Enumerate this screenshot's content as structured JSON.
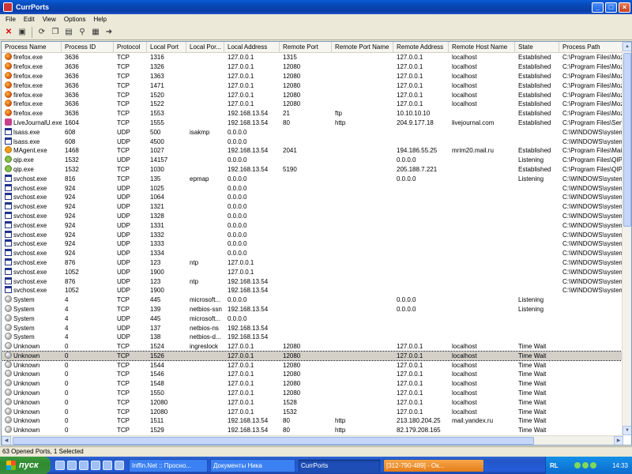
{
  "window": {
    "title": "CurrPorts"
  },
  "menu": [
    "File",
    "Edit",
    "View",
    "Options",
    "Help"
  ],
  "toolbar": {
    "icons": [
      "close-connection-icon",
      "save-icon",
      "refresh-icon",
      "copy-icon",
      "properties-icon",
      "find-icon",
      "html-report-icon",
      "exit-icon"
    ]
  },
  "columns": [
    "Process Name",
    "Process ID",
    "Protocol",
    "Local Port",
    "Local Por...",
    "Local Address",
    "Remote Port",
    "Remote Port Name",
    "Remote Address",
    "Remote Host Name",
    "State",
    "Process Path"
  ],
  "rows": [
    {
      "icon": "firefox",
      "name": "firefox.exe",
      "pid": "3636",
      "proto": "TCP",
      "lport": "1316",
      "lpname": "",
      "laddr": "127.0.0.1",
      "rport": "1315",
      "rpname": "",
      "raddr": "127.0.0.1",
      "rhost": "localhost",
      "state": "Established",
      "path": "C:\\Program Files\\Mozilla"
    },
    {
      "icon": "firefox",
      "name": "firefox.exe",
      "pid": "3636",
      "proto": "TCP",
      "lport": "1326",
      "lpname": "",
      "laddr": "127.0.0.1",
      "rport": "12080",
      "rpname": "",
      "raddr": "127.0.0.1",
      "rhost": "localhost",
      "state": "Established",
      "path": "C:\\Program Files\\Mozilla"
    },
    {
      "icon": "firefox",
      "name": "firefox.exe",
      "pid": "3636",
      "proto": "TCP",
      "lport": "1363",
      "lpname": "",
      "laddr": "127.0.0.1",
      "rport": "12080",
      "rpname": "",
      "raddr": "127.0.0.1",
      "rhost": "localhost",
      "state": "Established",
      "path": "C:\\Program Files\\Mozilla"
    },
    {
      "icon": "firefox",
      "name": "firefox.exe",
      "pid": "3636",
      "proto": "TCP",
      "lport": "1471",
      "lpname": "",
      "laddr": "127.0.0.1",
      "rport": "12080",
      "rpname": "",
      "raddr": "127.0.0.1",
      "rhost": "localhost",
      "state": "Established",
      "path": "C:\\Program Files\\Mozilla"
    },
    {
      "icon": "firefox",
      "name": "firefox.exe",
      "pid": "3636",
      "proto": "TCP",
      "lport": "1520",
      "lpname": "",
      "laddr": "127.0.0.1",
      "rport": "12080",
      "rpname": "",
      "raddr": "127.0.0.1",
      "rhost": "localhost",
      "state": "Established",
      "path": "C:\\Program Files\\Mozilla"
    },
    {
      "icon": "firefox",
      "name": "firefox.exe",
      "pid": "3636",
      "proto": "TCP",
      "lport": "1522",
      "lpname": "",
      "laddr": "127.0.0.1",
      "rport": "12080",
      "rpname": "",
      "raddr": "127.0.0.1",
      "rhost": "localhost",
      "state": "Established",
      "path": "C:\\Program Files\\Mozilla"
    },
    {
      "icon": "firefox",
      "name": "firefox.exe",
      "pid": "3636",
      "proto": "TCP",
      "lport": "1553",
      "lpname": "",
      "laddr": "192.168.13.54",
      "rport": "21",
      "rpname": "ftp",
      "raddr": "10.10.10.10",
      "rhost": "",
      "state": "Established",
      "path": "C:\\Program Files\\Mozilla"
    },
    {
      "icon": "lj",
      "name": "LiveJournalU.exe",
      "pid": "1604",
      "proto": "TCP",
      "lport": "1555",
      "lpname": "",
      "laddr": "192.168.13.54",
      "rport": "80",
      "rpname": "http",
      "raddr": "204.9.177.18",
      "rhost": "livejournal.com",
      "state": "Established",
      "path": "C:\\Program Files\\Semag"
    },
    {
      "icon": "win",
      "name": "lsass.exe",
      "pid": "608",
      "proto": "UDP",
      "lport": "500",
      "lpname": "isakmp",
      "laddr": "0.0.0.0",
      "rport": "",
      "rpname": "",
      "raddr": "",
      "rhost": "",
      "state": "",
      "path": "C:\\WINDOWS\\system32"
    },
    {
      "icon": "win",
      "name": "lsass.exe",
      "pid": "608",
      "proto": "UDP",
      "lport": "4500",
      "lpname": "",
      "laddr": "0.0.0.0",
      "rport": "",
      "rpname": "",
      "raddr": "",
      "rhost": "",
      "state": "",
      "path": "C:\\WINDOWS\\system32"
    },
    {
      "icon": "mail",
      "name": "MAgent.exe",
      "pid": "1468",
      "proto": "TCP",
      "lport": "1027",
      "lpname": "",
      "laddr": "192.168.13.54",
      "rport": "2041",
      "rpname": "",
      "raddr": "194.186.55.25",
      "rhost": "mrim20.mail.ru",
      "state": "Established",
      "path": "C:\\Program Files\\Mail.Ru"
    },
    {
      "icon": "qip",
      "name": "qip.exe",
      "pid": "1532",
      "proto": "UDP",
      "lport": "14157",
      "lpname": "",
      "laddr": "0.0.0.0",
      "rport": "",
      "rpname": "",
      "raddr": "0.0.0.0",
      "rhost": "",
      "state": "Listening",
      "path": "C:\\Program Files\\QIP\\qip"
    },
    {
      "icon": "qip",
      "name": "qip.exe",
      "pid": "1532",
      "proto": "TCP",
      "lport": "1030",
      "lpname": "",
      "laddr": "192.168.13.54",
      "rport": "5190",
      "rpname": "",
      "raddr": "205.188.7.221",
      "rhost": "",
      "state": "Established",
      "path": "C:\\Program Files\\QIP\\qip"
    },
    {
      "icon": "win",
      "name": "svchost.exe",
      "pid": "816",
      "proto": "TCP",
      "lport": "135",
      "lpname": "epmap",
      "laddr": "0.0.0.0",
      "rport": "",
      "rpname": "",
      "raddr": "0.0.0.0",
      "rhost": "",
      "state": "Listening",
      "path": "C:\\WINDOWS\\system32"
    },
    {
      "icon": "win",
      "name": "svchost.exe",
      "pid": "924",
      "proto": "UDP",
      "lport": "1025",
      "lpname": "",
      "laddr": "0.0.0.0",
      "rport": "",
      "rpname": "",
      "raddr": "",
      "rhost": "",
      "state": "",
      "path": "C:\\WINDOWS\\system32"
    },
    {
      "icon": "win",
      "name": "svchost.exe",
      "pid": "924",
      "proto": "UDP",
      "lport": "1064",
      "lpname": "",
      "laddr": "0.0.0.0",
      "rport": "",
      "rpname": "",
      "raddr": "",
      "rhost": "",
      "state": "",
      "path": "C:\\WINDOWS\\system32"
    },
    {
      "icon": "win",
      "name": "svchost.exe",
      "pid": "924",
      "proto": "UDP",
      "lport": "1321",
      "lpname": "",
      "laddr": "0.0.0.0",
      "rport": "",
      "rpname": "",
      "raddr": "",
      "rhost": "",
      "state": "",
      "path": "C:\\WINDOWS\\system32"
    },
    {
      "icon": "win",
      "name": "svchost.exe",
      "pid": "924",
      "proto": "UDP",
      "lport": "1328",
      "lpname": "",
      "laddr": "0.0.0.0",
      "rport": "",
      "rpname": "",
      "raddr": "",
      "rhost": "",
      "state": "",
      "path": "C:\\WINDOWS\\system32"
    },
    {
      "icon": "win",
      "name": "svchost.exe",
      "pid": "924",
      "proto": "UDP",
      "lport": "1331",
      "lpname": "",
      "laddr": "0.0.0.0",
      "rport": "",
      "rpname": "",
      "raddr": "",
      "rhost": "",
      "state": "",
      "path": "C:\\WINDOWS\\system32"
    },
    {
      "icon": "win",
      "name": "svchost.exe",
      "pid": "924",
      "proto": "UDP",
      "lport": "1332",
      "lpname": "",
      "laddr": "0.0.0.0",
      "rport": "",
      "rpname": "",
      "raddr": "",
      "rhost": "",
      "state": "",
      "path": "C:\\WINDOWS\\system32"
    },
    {
      "icon": "win",
      "name": "svchost.exe",
      "pid": "924",
      "proto": "UDP",
      "lport": "1333",
      "lpname": "",
      "laddr": "0.0.0.0",
      "rport": "",
      "rpname": "",
      "raddr": "",
      "rhost": "",
      "state": "",
      "path": "C:\\WINDOWS\\system32"
    },
    {
      "icon": "win",
      "name": "svchost.exe",
      "pid": "924",
      "proto": "UDP",
      "lport": "1334",
      "lpname": "",
      "laddr": "0.0.0.0",
      "rport": "",
      "rpname": "",
      "raddr": "",
      "rhost": "",
      "state": "",
      "path": "C:\\WINDOWS\\system32"
    },
    {
      "icon": "win",
      "name": "svchost.exe",
      "pid": "876",
      "proto": "UDP",
      "lport": "123",
      "lpname": "ntp",
      "laddr": "127.0.0.1",
      "rport": "",
      "rpname": "",
      "raddr": "",
      "rhost": "",
      "state": "",
      "path": "C:\\WINDOWS\\system32"
    },
    {
      "icon": "win",
      "name": "svchost.exe",
      "pid": "1052",
      "proto": "UDP",
      "lport": "1900",
      "lpname": "",
      "laddr": "127.0.0.1",
      "rport": "",
      "rpname": "",
      "raddr": "",
      "rhost": "",
      "state": "",
      "path": "C:\\WINDOWS\\system32"
    },
    {
      "icon": "win",
      "name": "svchost.exe",
      "pid": "876",
      "proto": "UDP",
      "lport": "123",
      "lpname": "ntp",
      "laddr": "192.168.13.54",
      "rport": "",
      "rpname": "",
      "raddr": "",
      "rhost": "",
      "state": "",
      "path": "C:\\WINDOWS\\system32"
    },
    {
      "icon": "win",
      "name": "svchost.exe",
      "pid": "1052",
      "proto": "UDP",
      "lport": "1900",
      "lpname": "",
      "laddr": "192.168.13.54",
      "rport": "",
      "rpname": "",
      "raddr": "",
      "rhost": "",
      "state": "",
      "path": "C:\\WINDOWS\\system32"
    },
    {
      "icon": "sys",
      "name": "System",
      "pid": "4",
      "proto": "TCP",
      "lport": "445",
      "lpname": "microsoft...",
      "laddr": "0.0.0.0",
      "rport": "",
      "rpname": "",
      "raddr": "0.0.0.0",
      "rhost": "",
      "state": "Listening",
      "path": ""
    },
    {
      "icon": "sys",
      "name": "System",
      "pid": "4",
      "proto": "TCP",
      "lport": "139",
      "lpname": "netbios-ssn",
      "laddr": "192.168.13.54",
      "rport": "",
      "rpname": "",
      "raddr": "0.0.0.0",
      "rhost": "",
      "state": "Listening",
      "path": ""
    },
    {
      "icon": "sys",
      "name": "System",
      "pid": "4",
      "proto": "UDP",
      "lport": "445",
      "lpname": "microsoft...",
      "laddr": "0.0.0.0",
      "rport": "",
      "rpname": "",
      "raddr": "",
      "rhost": "",
      "state": "",
      "path": ""
    },
    {
      "icon": "sys",
      "name": "System",
      "pid": "4",
      "proto": "UDP",
      "lport": "137",
      "lpname": "netbios-ns",
      "laddr": "192.168.13.54",
      "rport": "",
      "rpname": "",
      "raddr": "",
      "rhost": "",
      "state": "",
      "path": ""
    },
    {
      "icon": "sys",
      "name": "System",
      "pid": "4",
      "proto": "UDP",
      "lport": "138",
      "lpname": "netbios-d...",
      "laddr": "192.168.13.54",
      "rport": "",
      "rpname": "",
      "raddr": "",
      "rhost": "",
      "state": "",
      "path": ""
    },
    {
      "icon": "sys",
      "name": "Unknown",
      "pid": "0",
      "proto": "TCP",
      "lport": "1524",
      "lpname": "ingreslock",
      "laddr": "127.0.0.1",
      "rport": "12080",
      "rpname": "",
      "raddr": "127.0.0.1",
      "rhost": "localhost",
      "state": "Time Wait",
      "path": ""
    },
    {
      "icon": "sys",
      "name": "Unknown",
      "pid": "0",
      "proto": "TCP",
      "lport": "1526",
      "lpname": "",
      "laddr": "127.0.0.1",
      "rport": "12080",
      "rpname": "",
      "raddr": "127.0.0.1",
      "rhost": "localhost",
      "state": "Time Wait",
      "path": "",
      "selected": true
    },
    {
      "icon": "sys",
      "name": "Unknown",
      "pid": "0",
      "proto": "TCP",
      "lport": "1544",
      "lpname": "",
      "laddr": "127.0.0.1",
      "rport": "12080",
      "rpname": "",
      "raddr": "127.0.0.1",
      "rhost": "localhost",
      "state": "Time Wait",
      "path": ""
    },
    {
      "icon": "sys",
      "name": "Unknown",
      "pid": "0",
      "proto": "TCP",
      "lport": "1546",
      "lpname": "",
      "laddr": "127.0.0.1",
      "rport": "12080",
      "rpname": "",
      "raddr": "127.0.0.1",
      "rhost": "localhost",
      "state": "Time Wait",
      "path": ""
    },
    {
      "icon": "sys",
      "name": "Unknown",
      "pid": "0",
      "proto": "TCP",
      "lport": "1548",
      "lpname": "",
      "laddr": "127.0.0.1",
      "rport": "12080",
      "rpname": "",
      "raddr": "127.0.0.1",
      "rhost": "localhost",
      "state": "Time Wait",
      "path": ""
    },
    {
      "icon": "sys",
      "name": "Unknown",
      "pid": "0",
      "proto": "TCP",
      "lport": "1550",
      "lpname": "",
      "laddr": "127.0.0.1",
      "rport": "12080",
      "rpname": "",
      "raddr": "127.0.0.1",
      "rhost": "localhost",
      "state": "Time Wait",
      "path": ""
    },
    {
      "icon": "sys",
      "name": "Unknown",
      "pid": "0",
      "proto": "TCP",
      "lport": "12080",
      "lpname": "",
      "laddr": "127.0.0.1",
      "rport": "1528",
      "rpname": "",
      "raddr": "127.0.0.1",
      "rhost": "localhost",
      "state": "Time Wait",
      "path": ""
    },
    {
      "icon": "sys",
      "name": "Unknown",
      "pid": "0",
      "proto": "TCP",
      "lport": "12080",
      "lpname": "",
      "laddr": "127.0.0.1",
      "rport": "1532",
      "rpname": "",
      "raddr": "127.0.0.1",
      "rhost": "localhost",
      "state": "Time Wait",
      "path": ""
    },
    {
      "icon": "sys",
      "name": "Unknown",
      "pid": "0",
      "proto": "TCP",
      "lport": "1511",
      "lpname": "",
      "laddr": "192.168.13.54",
      "rport": "80",
      "rpname": "http",
      "raddr": "213.180.204.25",
      "rhost": "mail.yandex.ru",
      "state": "Time Wait",
      "path": ""
    },
    {
      "icon": "sys",
      "name": "Unknown",
      "pid": "0",
      "proto": "TCP",
      "lport": "1529",
      "lpname": "",
      "laddr": "192.168.13.54",
      "rport": "80",
      "rpname": "http",
      "raddr": "82.179.208.165",
      "rhost": "",
      "state": "Time Wait",
      "path": ""
    }
  ],
  "status": {
    "text": "63 Opened Ports, 1 Selected"
  },
  "taskbar": {
    "start_label": "пуск",
    "tasks": [
      {
        "label": "Inffin.Net :: Просно...",
        "style": ""
      },
      {
        "label": "Документы Ника",
        "style": ""
      },
      {
        "label": "CurrPorts",
        "style": "active"
      },
      {
        "label": "[312-790-489] - Ок...",
        "style": "orange"
      }
    ],
    "lang": "RL",
    "clock": "14:33"
  }
}
